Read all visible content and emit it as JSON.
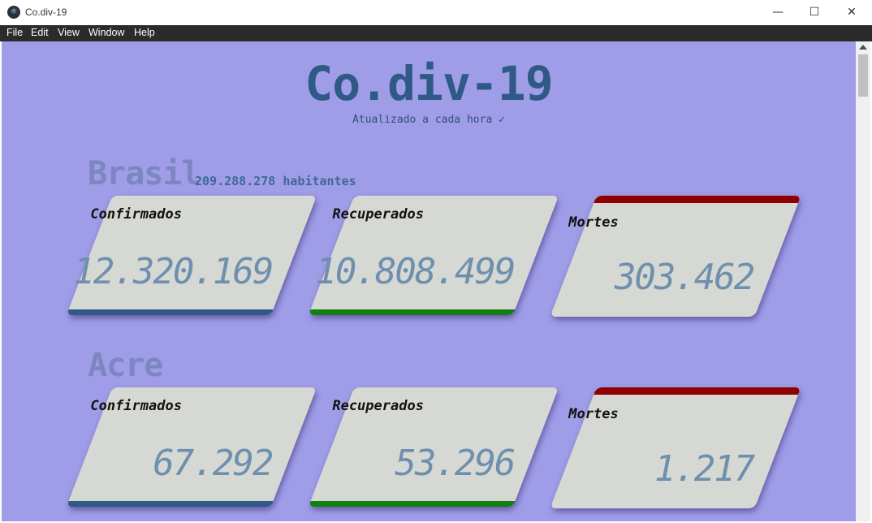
{
  "window": {
    "title": "Co.div-19",
    "minimize_glyph": "—",
    "maximize_glyph": "☐",
    "close_glyph": "✕"
  },
  "menu": [
    "File",
    "Edit",
    "View",
    "Window",
    "Help"
  ],
  "header": {
    "title": "Co.div-19",
    "subtitle": "Atualizado a cada hora ✓"
  },
  "regions": [
    {
      "name": "Brasil",
      "population": "209.288.278 habitantes",
      "cards": {
        "confirmed": {
          "label": "Confirmados",
          "value": "12.320.169"
        },
        "recovered": {
          "label": "Recuperados",
          "value": "10.808.499"
        },
        "deaths": {
          "label": "Mortes",
          "value": "303.462"
        }
      }
    },
    {
      "name": "Acre",
      "cards": {
        "confirmed": {
          "label": "Confirmados",
          "value": "67.292"
        },
        "recovered": {
          "label": "Recuperados",
          "value": "53.296"
        },
        "deaths": {
          "label": "Mortes",
          "value": "1.217"
        }
      }
    }
  ],
  "colors": {
    "background": "#a09de8",
    "confirmed": "#2f5a86",
    "recovered": "#118011",
    "deaths": "#900000",
    "card": "#d5d8d3",
    "value_text": "#6f8fae"
  }
}
